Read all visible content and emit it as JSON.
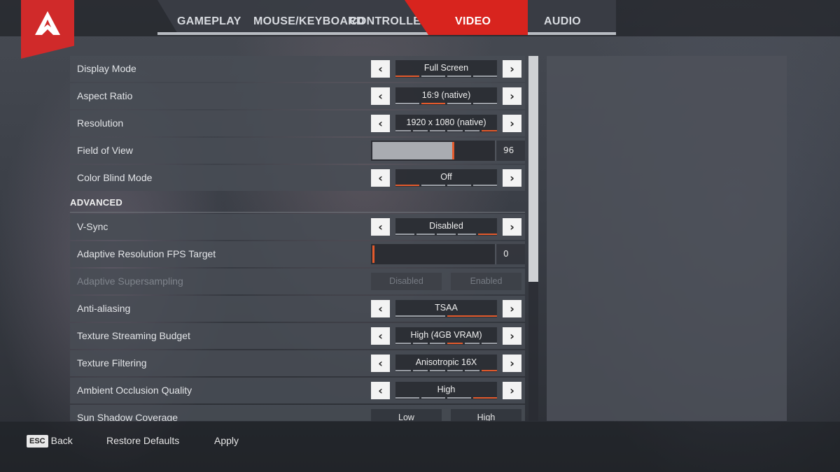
{
  "tabs": [
    {
      "label": "GAMEPLAY",
      "active": false
    },
    {
      "label": "MOUSE/KEYBOARD",
      "active": false
    },
    {
      "label": "CONTROLLER",
      "active": false
    },
    {
      "label": "VIDEO",
      "active": true
    },
    {
      "label": "AUDIO",
      "active": false
    }
  ],
  "colors": {
    "accent": "#d8241e",
    "segment_on": "#e45a2c"
  },
  "settings": {
    "display_mode": {
      "label": "Display Mode",
      "value": "Full Screen",
      "segments": 4,
      "selected": 0
    },
    "aspect_ratio": {
      "label": "Aspect Ratio",
      "value": "16:9 (native)",
      "segments": 4,
      "selected": 1
    },
    "resolution": {
      "label": "Resolution",
      "value": "1920 x 1080 (native)",
      "segments": 6,
      "selected": 5
    },
    "fov": {
      "label": "Field of View",
      "value": "96",
      "fraction": 0.66
    },
    "color_blind": {
      "label": "Color Blind Mode",
      "value": "Off",
      "segments": 4,
      "selected": 0
    },
    "advanced_heading": "ADVANCED",
    "vsync": {
      "label": "V-Sync",
      "value": "Disabled",
      "segments": 5,
      "selected": 4
    },
    "adaptive_fps": {
      "label": "Adaptive Resolution FPS Target",
      "value": "0",
      "fraction": 0.0
    },
    "adaptive_ss": {
      "label": "Adaptive Supersampling",
      "option_a": "Disabled",
      "option_b": "Enabled"
    },
    "anti_aliasing": {
      "label": "Anti-aliasing",
      "value": "TSAA",
      "segments": 2,
      "selected": 1
    },
    "texture_budget": {
      "label": "Texture Streaming Budget",
      "value": "High (4GB VRAM)",
      "segments": 6,
      "selected": 3
    },
    "texture_filtering": {
      "label": "Texture Filtering",
      "value": "Anisotropic 16X",
      "segments": 6,
      "selected": 5
    },
    "ambient_occlusion": {
      "label": "Ambient Occlusion Quality",
      "value": "High",
      "segments": 4,
      "selected": 3
    },
    "sun_shadow": {
      "label": "Sun Shadow Coverage",
      "option_a": "Low",
      "option_b": "High"
    }
  },
  "footer": {
    "esc_key": "ESC",
    "back": "Back",
    "restore": "Restore Defaults",
    "apply": "Apply"
  }
}
